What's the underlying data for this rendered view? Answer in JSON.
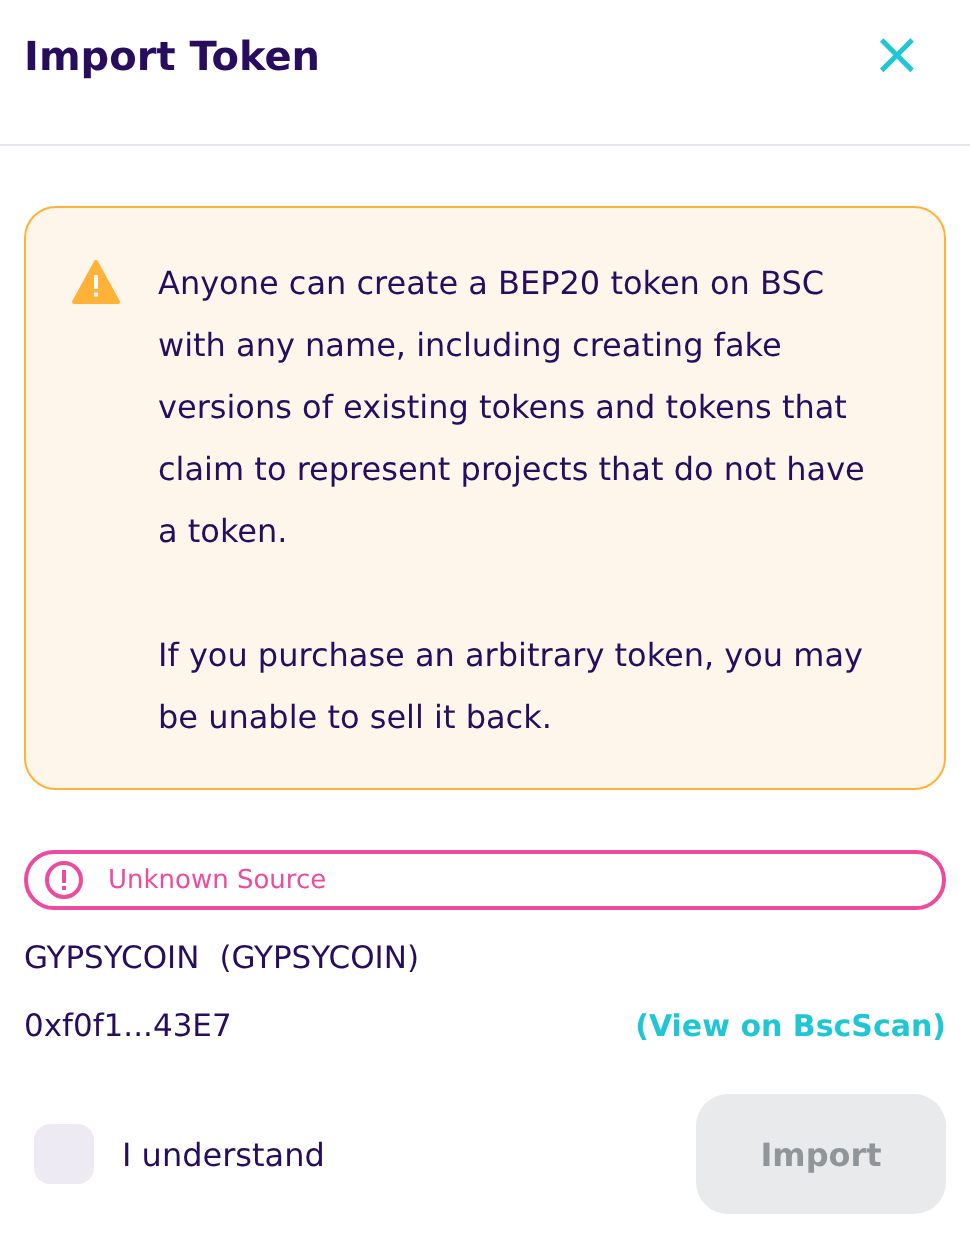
{
  "window": {
    "title": "Import Token",
    "close": "×"
  },
  "warning": {
    "paragraphs": [
      "Anyone can create a BEP20 token on BSC with any name, including creating fake versions of existing tokens and tokens that claim to represent projects that do not have a token.",
      "If you purchase an arbitrary token, you may be unable to sell it back."
    ]
  },
  "source_badge": {
    "label": "Unknown Source"
  },
  "token": {
    "name": "GYPSYCOIN",
    "symbol": "(GYPSYCOIN)",
    "address": "0xf0f1...43E7",
    "explorer_link": "(View on BscScan)"
  },
  "understand": {
    "label": "I understand",
    "checked": false
  },
  "import_button": {
    "label": "Import",
    "disabled": true
  }
}
